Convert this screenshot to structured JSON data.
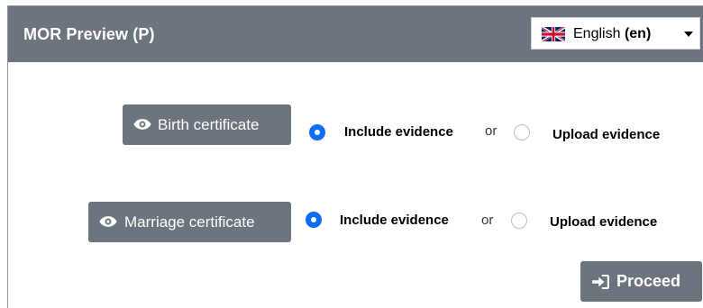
{
  "header": {
    "title": "MOR Preview (P)",
    "language": {
      "name": "English",
      "code": "(en)",
      "flag_icon": "uk-flag-icon"
    }
  },
  "documents": [
    {
      "label": "Birth certificate",
      "icon": "eye-icon",
      "include_label": "Include evidence",
      "or_text": "or",
      "upload_label": "Upload evidence",
      "selected": "include"
    },
    {
      "label": "Marriage certificate",
      "icon": "eye-icon",
      "include_label": "Include evidence",
      "or_text": "or",
      "upload_label": "Upload evidence",
      "selected": "include"
    }
  ],
  "actions": {
    "proceed_label": "Proceed",
    "proceed_icon": "sign-in-arrow-icon"
  },
  "colors": {
    "header_bg": "#6c757d",
    "button_bg": "#6c757d",
    "radio_checked": "#0d6efd"
  }
}
